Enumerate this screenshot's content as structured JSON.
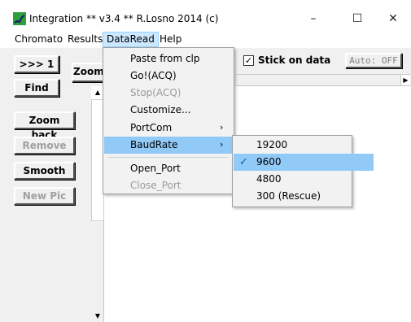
{
  "window": {
    "title": "Integration ** v3.4 **  R.Losno 2014 (c)",
    "minimize_glyph": "–",
    "maximize_glyph": "☐",
    "close_glyph": "✕"
  },
  "menubar": {
    "items": [
      "Chromato",
      "Results",
      "DataRead",
      "Help"
    ],
    "active": "DataRead"
  },
  "buttons": {
    "next_label": ">>> 1",
    "find_label": "Find",
    "zoom_label": "Zoom",
    "zoom_back_label": "Zoom back",
    "remove_label": "Remove",
    "smooth_label": "Smooth",
    "new_pic_label": "New Pic",
    "auto_off_label": "Auto: OFF"
  },
  "stick": {
    "label": "Stick on data",
    "checked": true,
    "check_glyph": "✓"
  },
  "dataread_menu": {
    "items": [
      {
        "label": "Paste from clp",
        "disabled": false,
        "submenu": false
      },
      {
        "label": "Go!(ACQ)",
        "disabled": false,
        "submenu": false
      },
      {
        "label": "Stop(ACQ)",
        "disabled": true,
        "submenu": false
      },
      {
        "label": "Customize...",
        "disabled": false,
        "submenu": false
      },
      {
        "label": "PortCom",
        "disabled": false,
        "submenu": true
      },
      {
        "label": "BaudRate",
        "disabled": false,
        "submenu": true,
        "highlighted": true
      },
      {
        "label": "Open_Port",
        "disabled": false,
        "submenu": false
      },
      {
        "label": "Close_Port",
        "disabled": true,
        "submenu": false
      }
    ],
    "arrow_glyph": "›"
  },
  "baudrate_menu": {
    "items": [
      {
        "label": "19200",
        "checked": false
      },
      {
        "label": "9600",
        "checked": true,
        "highlighted": true
      },
      {
        "label": "4800",
        "checked": false
      },
      {
        "label": "300 (Rescue)",
        "checked": false
      }
    ],
    "check_glyph": "✓"
  },
  "scroll": {
    "up_glyph": "▲",
    "down_glyph": "▼",
    "right_glyph": "▶"
  },
  "colors": {
    "menu_highlight": "#91c9f7",
    "menubar_active": "#cce8ff",
    "check": "#0063b1",
    "app_icon_green": "#2e9e3e"
  }
}
